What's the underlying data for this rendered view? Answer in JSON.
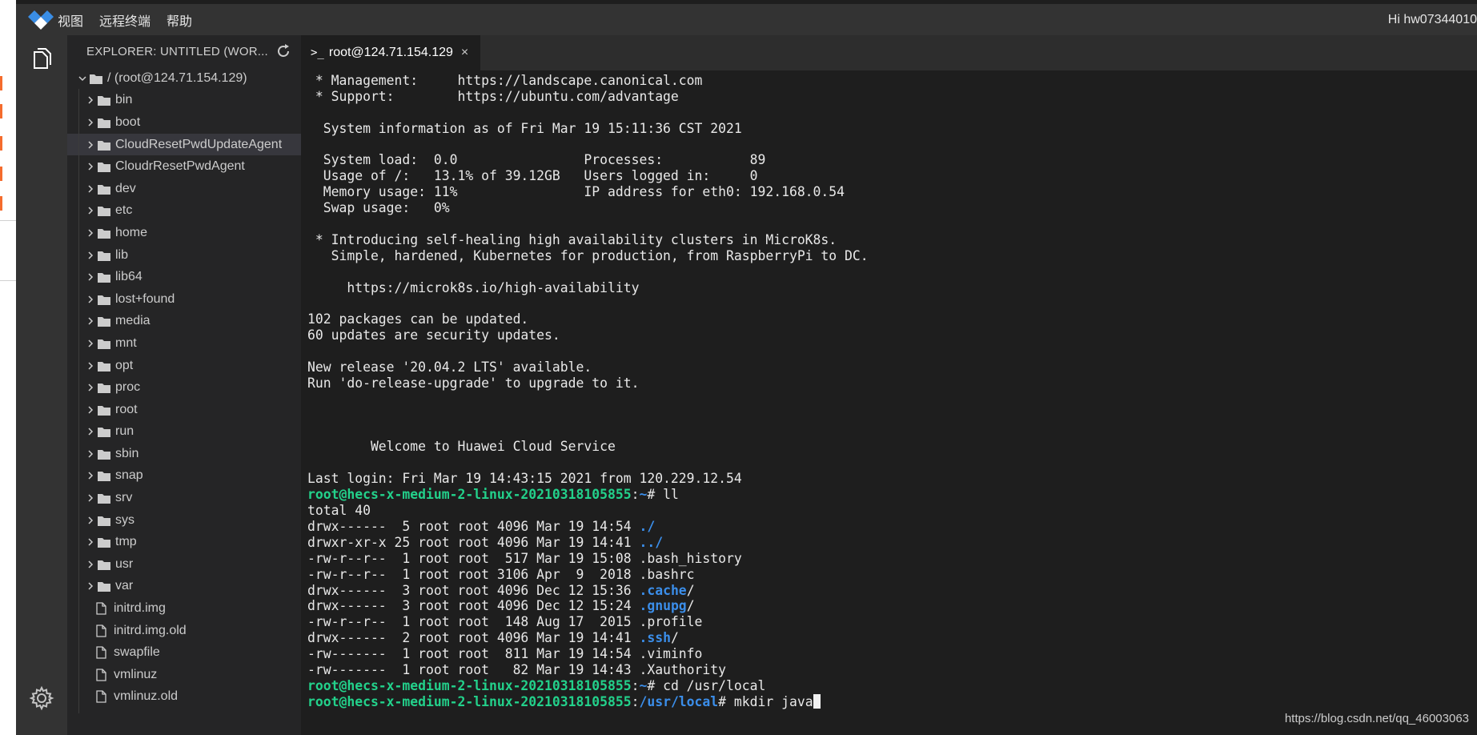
{
  "menubar": {
    "items": [
      "视图",
      "远程终端",
      "帮助"
    ],
    "greeting": "Hi hw07344010"
  },
  "sidebar": {
    "header": "EXPLORER: UNTITLED (WOR...",
    "root": "/ (root@124.71.154.129)",
    "folders": [
      "bin",
      "boot",
      "CloudResetPwdUpdateAgent",
      "CloudrResetPwdAgent",
      "dev",
      "etc",
      "home",
      "lib",
      "lib64",
      "lost+found",
      "media",
      "mnt",
      "opt",
      "proc",
      "root",
      "run",
      "sbin",
      "snap",
      "srv",
      "sys",
      "tmp",
      "usr",
      "var"
    ],
    "selected_folder": "CloudResetPwdUpdateAgent",
    "files": [
      "initrd.img",
      "initrd.img.old",
      "swapfile",
      "vmlinuz",
      "vmlinuz.old"
    ]
  },
  "tab": {
    "title": "root@124.71.154.129",
    "close": "×",
    "icon": "terminal-prompt-icon"
  },
  "terminal": {
    "lines": [
      [
        {
          "t": " * Management:     https://landscape.canonical.com"
        }
      ],
      [
        {
          "t": " * Support:        https://ubuntu.com/advantage"
        }
      ],
      [
        {
          "t": ""
        }
      ],
      [
        {
          "t": "  System information as of Fri Mar 19 15:11:36 CST 2021"
        }
      ],
      [
        {
          "t": ""
        }
      ],
      [
        {
          "t": "  System load:  0.0                Processes:           89"
        }
      ],
      [
        {
          "t": "  Usage of /:   13.1% of 39.12GB   Users logged in:     0"
        }
      ],
      [
        {
          "t": "  Memory usage: 11%                IP address for eth0: 192.168.0.54"
        }
      ],
      [
        {
          "t": "  Swap usage:   0%"
        }
      ],
      [
        {
          "t": ""
        }
      ],
      [
        {
          "t": " * Introducing self-healing high availability clusters in MicroK8s."
        }
      ],
      [
        {
          "t": "   Simple, hardened, Kubernetes for production, from RaspberryPi to DC."
        }
      ],
      [
        {
          "t": ""
        }
      ],
      [
        {
          "t": "     https://microk8s.io/high-availability"
        }
      ],
      [
        {
          "t": ""
        }
      ],
      [
        {
          "t": "102 packages can be updated."
        }
      ],
      [
        {
          "t": "60 updates are security updates."
        }
      ],
      [
        {
          "t": ""
        }
      ],
      [
        {
          "t": "New release '20.04.2 LTS' available."
        }
      ],
      [
        {
          "t": "Run 'do-release-upgrade' to upgrade to it."
        }
      ],
      [
        {
          "t": ""
        }
      ],
      [
        {
          "t": ""
        }
      ],
      [
        {
          "t": ""
        }
      ],
      [
        {
          "t": "        Welcome to Huawei Cloud Service"
        }
      ],
      [
        {
          "t": ""
        }
      ],
      [
        {
          "t": "Last login: Fri Mar 19 14:43:15 2021 from 120.229.12.54"
        }
      ],
      [
        {
          "t": "root@hecs-x-medium-2-linux-20210318105855",
          "c": "green"
        },
        {
          "t": ":"
        },
        {
          "t": "~",
          "c": "blue"
        },
        {
          "t": "# ll"
        }
      ],
      [
        {
          "t": "total 40"
        }
      ],
      [
        {
          "t": "drwx------  5 root root 4096 Mar 19 14:54 "
        },
        {
          "t": "./",
          "c": "blue"
        }
      ],
      [
        {
          "t": "drwxr-xr-x 25 root root 4096 Mar 19 14:41 "
        },
        {
          "t": "../",
          "c": "blue"
        }
      ],
      [
        {
          "t": "-rw-r--r--  1 root root  517 Mar 19 15:08 .bash_history"
        }
      ],
      [
        {
          "t": "-rw-r--r--  1 root root 3106 Apr  9  2018 .bashrc"
        }
      ],
      [
        {
          "t": "drwx------  3 root root 4096 Dec 12 15:36 "
        },
        {
          "t": ".cache",
          "c": "blue"
        },
        {
          "t": "/"
        }
      ],
      [
        {
          "t": "drwx------  3 root root 4096 Dec 12 15:24 "
        },
        {
          "t": ".gnupg",
          "c": "blue"
        },
        {
          "t": "/"
        }
      ],
      [
        {
          "t": "-rw-r--r--  1 root root  148 Aug 17  2015 .profile"
        }
      ],
      [
        {
          "t": "drwx------  2 root root 4096 Mar 19 14:41 "
        },
        {
          "t": ".ssh",
          "c": "blue"
        },
        {
          "t": "/"
        }
      ],
      [
        {
          "t": "-rw-------  1 root root  811 Mar 19 14:54 .viminfo"
        }
      ],
      [
        {
          "t": "-rw-------  1 root root   82 Mar 19 14:43 .Xauthority"
        }
      ],
      [
        {
          "t": "root@hecs-x-medium-2-linux-20210318105855",
          "c": "green"
        },
        {
          "t": ":"
        },
        {
          "t": "~",
          "c": "blue"
        },
        {
          "t": "# cd /usr/local"
        }
      ],
      [
        {
          "t": "root@hecs-x-medium-2-linux-20210318105855",
          "c": "green"
        },
        {
          "t": ":"
        },
        {
          "t": "/usr/local",
          "c": "blue"
        },
        {
          "t": "# mkdir java"
        }
      ]
    ]
  },
  "watermark": "https://blog.csdn.net/qq_46003063",
  "colors": {
    "prompt_user": "#23d18b",
    "prompt_path": "#3b8eea",
    "accent_logo": "#3a8ee6"
  }
}
